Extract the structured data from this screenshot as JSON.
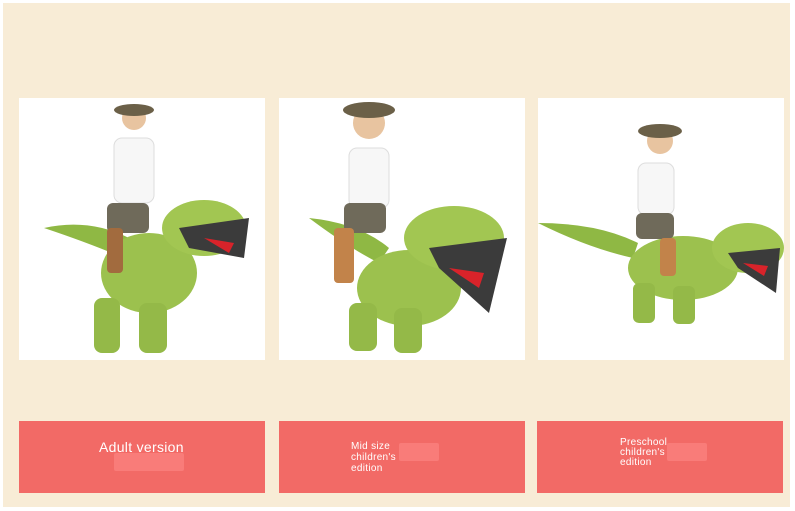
{
  "colors": {
    "background": "#f8ecd6",
    "label_background": "#f26a66",
    "label_text": "#ffffff",
    "costume_green": "#9cc14e"
  },
  "products": [
    {
      "image_alt": "adult-dinosaur-costume-photo",
      "label": "Adult version"
    },
    {
      "image_alt": "mid-size-child-dinosaur-costume-photo",
      "label": "Mid size\nchildren's\nedition"
    },
    {
      "image_alt": "preschool-child-dinosaur-costume-photo",
      "label": "Preschool\nchildren's\nedition"
    }
  ]
}
